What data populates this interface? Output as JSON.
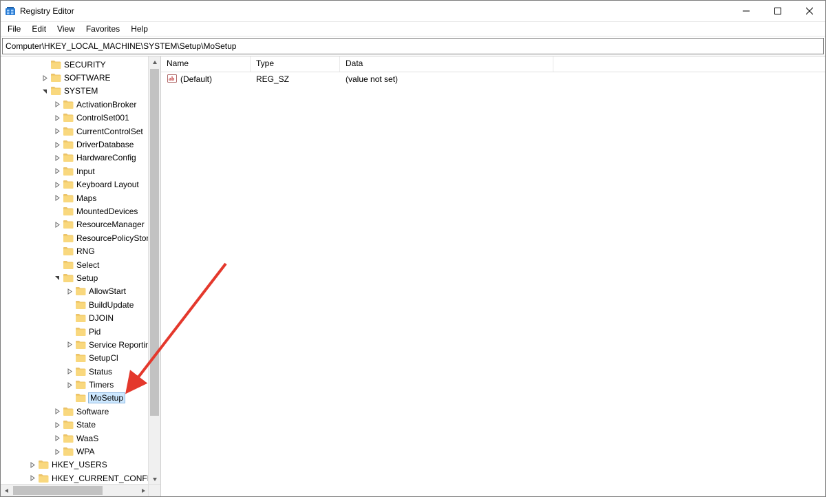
{
  "window": {
    "title": "Registry Editor"
  },
  "menu": {
    "file": "File",
    "edit": "Edit",
    "view": "View",
    "favorites": "Favorites",
    "help": "Help"
  },
  "addressbar": {
    "path": "Computer\\HKEY_LOCAL_MACHINE\\SYSTEM\\Setup\\MoSetup"
  },
  "tree": {
    "items": [
      {
        "indent": 3,
        "expander": "none",
        "label": "SECURITY"
      },
      {
        "indent": 3,
        "expander": "closed",
        "label": "SOFTWARE"
      },
      {
        "indent": 3,
        "expander": "open",
        "label": "SYSTEM"
      },
      {
        "indent": 4,
        "expander": "closed",
        "label": "ActivationBroker"
      },
      {
        "indent": 4,
        "expander": "closed",
        "label": "ControlSet001"
      },
      {
        "indent": 4,
        "expander": "closed",
        "label": "CurrentControlSet"
      },
      {
        "indent": 4,
        "expander": "closed",
        "label": "DriverDatabase"
      },
      {
        "indent": 4,
        "expander": "closed",
        "label": "HardwareConfig"
      },
      {
        "indent": 4,
        "expander": "closed",
        "label": "Input"
      },
      {
        "indent": 4,
        "expander": "closed",
        "label": "Keyboard Layout"
      },
      {
        "indent": 4,
        "expander": "closed",
        "label": "Maps"
      },
      {
        "indent": 4,
        "expander": "none",
        "label": "MountedDevices"
      },
      {
        "indent": 4,
        "expander": "closed",
        "label": "ResourceManager"
      },
      {
        "indent": 4,
        "expander": "none",
        "label": "ResourcePolicyStore"
      },
      {
        "indent": 4,
        "expander": "none",
        "label": "RNG"
      },
      {
        "indent": 4,
        "expander": "none",
        "label": "Select"
      },
      {
        "indent": 4,
        "expander": "open",
        "label": "Setup"
      },
      {
        "indent": 5,
        "expander": "closed",
        "label": "AllowStart"
      },
      {
        "indent": 5,
        "expander": "none",
        "label": "BuildUpdate"
      },
      {
        "indent": 5,
        "expander": "none",
        "label": "DJOIN"
      },
      {
        "indent": 5,
        "expander": "none",
        "label": "Pid"
      },
      {
        "indent": 5,
        "expander": "closed",
        "label": "Service Reporting"
      },
      {
        "indent": 5,
        "expander": "none",
        "label": "SetupCl"
      },
      {
        "indent": 5,
        "expander": "closed",
        "label": "Status"
      },
      {
        "indent": 5,
        "expander": "closed",
        "label": "Timers"
      },
      {
        "indent": 5,
        "expander": "none",
        "label": "MoSetup",
        "selected": true
      },
      {
        "indent": 4,
        "expander": "closed",
        "label": "Software"
      },
      {
        "indent": 4,
        "expander": "closed",
        "label": "State"
      },
      {
        "indent": 4,
        "expander": "closed",
        "label": "WaaS"
      },
      {
        "indent": 4,
        "expander": "closed",
        "label": "WPA"
      },
      {
        "indent": 2,
        "expander": "closed",
        "label": "HKEY_USERS"
      },
      {
        "indent": 2,
        "expander": "closed",
        "label": "HKEY_CURRENT_CONFIG"
      }
    ]
  },
  "values": {
    "columns": {
      "name": "Name",
      "type": "Type",
      "data": "Data"
    },
    "rows": [
      {
        "name": "(Default)",
        "type": "REG_SZ",
        "data": "(value not set)"
      }
    ]
  }
}
